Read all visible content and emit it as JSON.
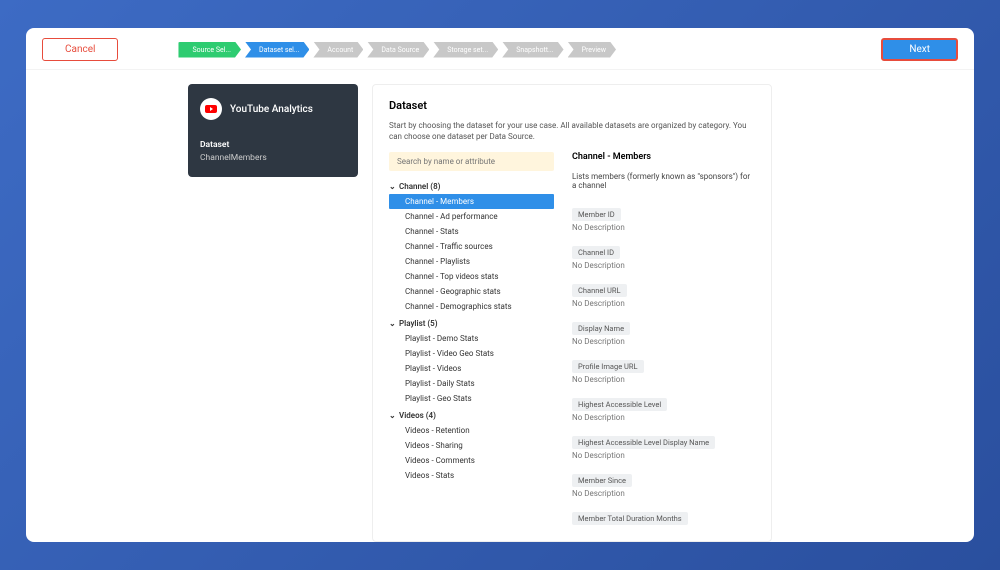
{
  "topbar": {
    "cancel": "Cancel",
    "next": "Next",
    "steps": [
      "Source Sel...",
      "Dataset sel...",
      "Account",
      "Data Source",
      "Storage set...",
      "Snapshott...",
      "Preview"
    ]
  },
  "sidebar": {
    "product": "YouTube Analytics",
    "section_label": "Dataset",
    "dataset_name": "ChannelMembers"
  },
  "main": {
    "heading": "Dataset",
    "description": "Start by choosing the dataset for your use case. All available datasets are organized by category. You can choose one dataset per Data Source.",
    "search_placeholder": "Search by name or attribute"
  },
  "tree": [
    {
      "group": "Channel (8)",
      "items": [
        "Channel - Members",
        "Channel - Ad performance",
        "Channel - Stats",
        "Channel - Traffic sources",
        "Channel - Playlists",
        "Channel - Top videos stats",
        "Channel - Geographic stats",
        "Channel - Demographics stats"
      ],
      "selected": 0
    },
    {
      "group": "Playlist (5)",
      "items": [
        "Playlist - Demo Stats",
        "Playlist - Video Geo Stats",
        "Playlist - Videos",
        "Playlist - Daily Stats",
        "Playlist - Geo Stats"
      ]
    },
    {
      "group": "Videos (4)",
      "items": [
        "Videos - Retention",
        "Videos - Sharing",
        "Videos - Comments",
        "Videos - Stats"
      ]
    }
  ],
  "detail": {
    "title": "Channel - Members",
    "subtitle": "Lists members (formerly known as \"sponsors\") for a channel",
    "no_desc": "No Description",
    "attributes": [
      "Member ID",
      "Channel ID",
      "Channel URL",
      "Display Name",
      "Profile Image URL",
      "Highest Accessible Level",
      "Highest Accessible Level Display Name",
      "Member Since",
      "Member Total Duration Months"
    ]
  }
}
